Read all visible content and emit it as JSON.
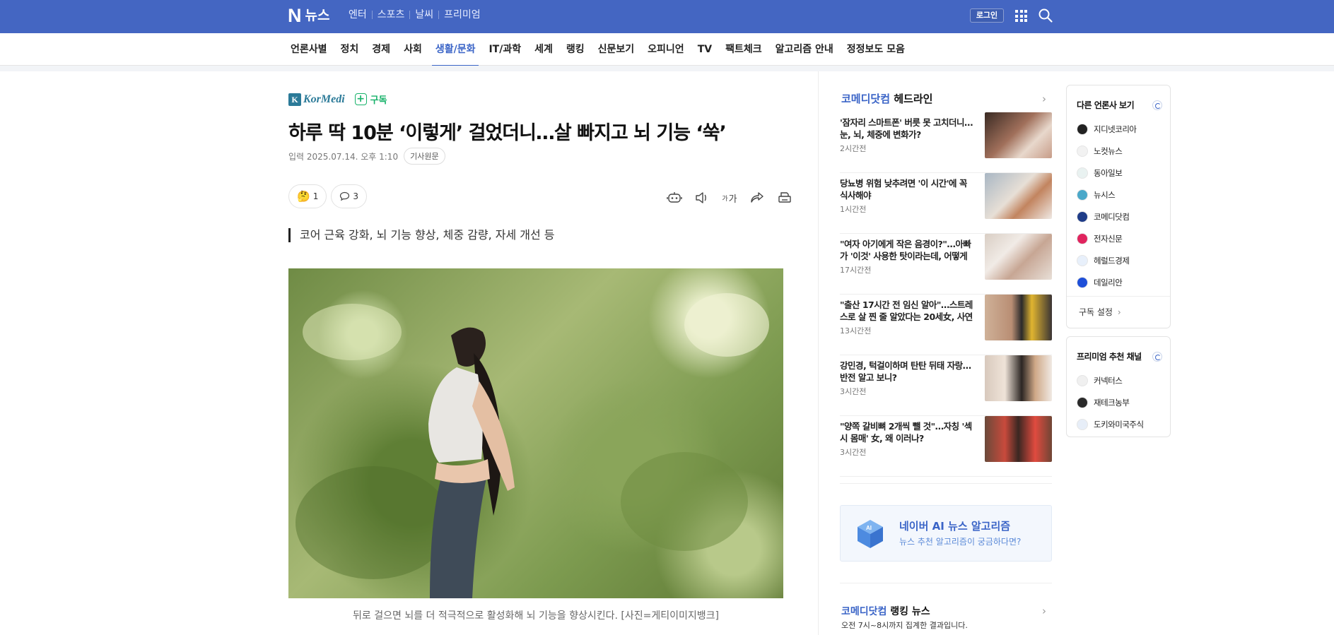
{
  "topbar": {
    "logo": "N",
    "section": "뉴스",
    "links": [
      "엔터",
      "스포츠",
      "날씨",
      "프리미엄"
    ],
    "login": "로그인",
    "icons": [
      "apps-grid-icon",
      "search-icon"
    ]
  },
  "categories": [
    {
      "label": "언론사별",
      "active": false
    },
    {
      "label": "정치",
      "active": false
    },
    {
      "label": "경제",
      "active": false
    },
    {
      "label": "사회",
      "active": false
    },
    {
      "label": "생활/문화",
      "active": true
    },
    {
      "label": "IT/과학",
      "active": false
    },
    {
      "label": "세계",
      "active": false
    },
    {
      "label": "랭킹",
      "active": false
    },
    {
      "label": "신문보기",
      "active": false
    },
    {
      "label": "오피니언",
      "active": false
    },
    {
      "label": "TV",
      "active": false
    },
    {
      "label": "팩트체크",
      "active": false
    },
    {
      "label": "알고리즘 안내",
      "active": false
    },
    {
      "label": "정정보도 모음",
      "active": false
    }
  ],
  "article": {
    "press": "KorMedi",
    "subscribe": "구독",
    "title": "하루 딱 10분 ‘이렇게’ 걸었더니…살 빠지고 뇌 기능 ‘쑥’",
    "date": "입력 2025.07.14. 오후 1:10",
    "origin_button": "기사원문",
    "reaction_count": "1",
    "comment_count": "3",
    "font_size_label": "가",
    "summary": "코어 근육 강화, 뇌 기능 향상, 체중 감량, 자세 개선 등",
    "caption": "뒤로 걸으면 뇌를 더 적극적으로 활성화해 뇌 기능을 향상시킨다. [사진=게티이미지뱅크]"
  },
  "headlines": {
    "press": "코메디닷컴",
    "title": "헤드라인",
    "items": [
      {
        "title": "'잠자리 스마트폰' 버릇 못 고치더니… 눈, 뇌, 체중에 변화가?",
        "time": "2시간전"
      },
      {
        "title": "당뇨병 위험 낮추려면 '이 시간'에 꼭 식사해야",
        "time": "1시간전"
      },
      {
        "title": "\"여자 아기에게 작은 음경이?\"…아빠가 '이것' 사용한 탓이라는데, 어떻게 …",
        "time": "17시간전"
      },
      {
        "title": "\"출산 17시간 전 임신 알아\"…스트레스로 살 찐 줄 알았다는 20세女, 사연은?",
        "time": "13시간전"
      },
      {
        "title": "강민경, 턱걸이하며 탄탄 뒤태 자랑… 반전 알고 보니?",
        "time": "3시간전"
      },
      {
        "title": "\"양쪽 갈비뼈 2개씩 뺄 것\"…자칭 '섹시 몸매' 女, 왜 이러나?",
        "time": "3시간전"
      }
    ]
  },
  "ai_promo": {
    "title": "네이버 AI 뉴스 알고리즘",
    "subtitle": "뉴스 추천 알고리즘이 궁금하다면?"
  },
  "ranking": {
    "press": "코메디닷컴",
    "title": "랭킹 뉴스",
    "subtitle": "오전 7시~8시까지 집계한 결과입니다."
  },
  "other_press": {
    "title": "다른 언론사 보기",
    "items": [
      {
        "name": "지디넷코리아",
        "color": "#222222"
      },
      {
        "name": "노컷뉴스",
        "color": "#f2f2f2"
      },
      {
        "name": "동아일보",
        "color": "#e9f2f1"
      },
      {
        "name": "뉴시스",
        "color": "#4aa8c9"
      },
      {
        "name": "코메디닷컴",
        "color": "#1f3c88"
      },
      {
        "name": "전자신문",
        "color": "#e0245e"
      },
      {
        "name": "헤럴드경제",
        "color": "#e8f0fb"
      },
      {
        "name": "데일리안",
        "color": "#1e4fd8"
      }
    ],
    "setting": "구독 설정"
  },
  "premium": {
    "title": "프리미엄 추천 채널",
    "items": [
      {
        "name": "커넥터스",
        "color": "#f0f0f0"
      },
      {
        "name": "재테크농부",
        "color": "#2a2a2a"
      },
      {
        "name": "도키와미국주식",
        "color": "#e7eef8"
      }
    ]
  }
}
